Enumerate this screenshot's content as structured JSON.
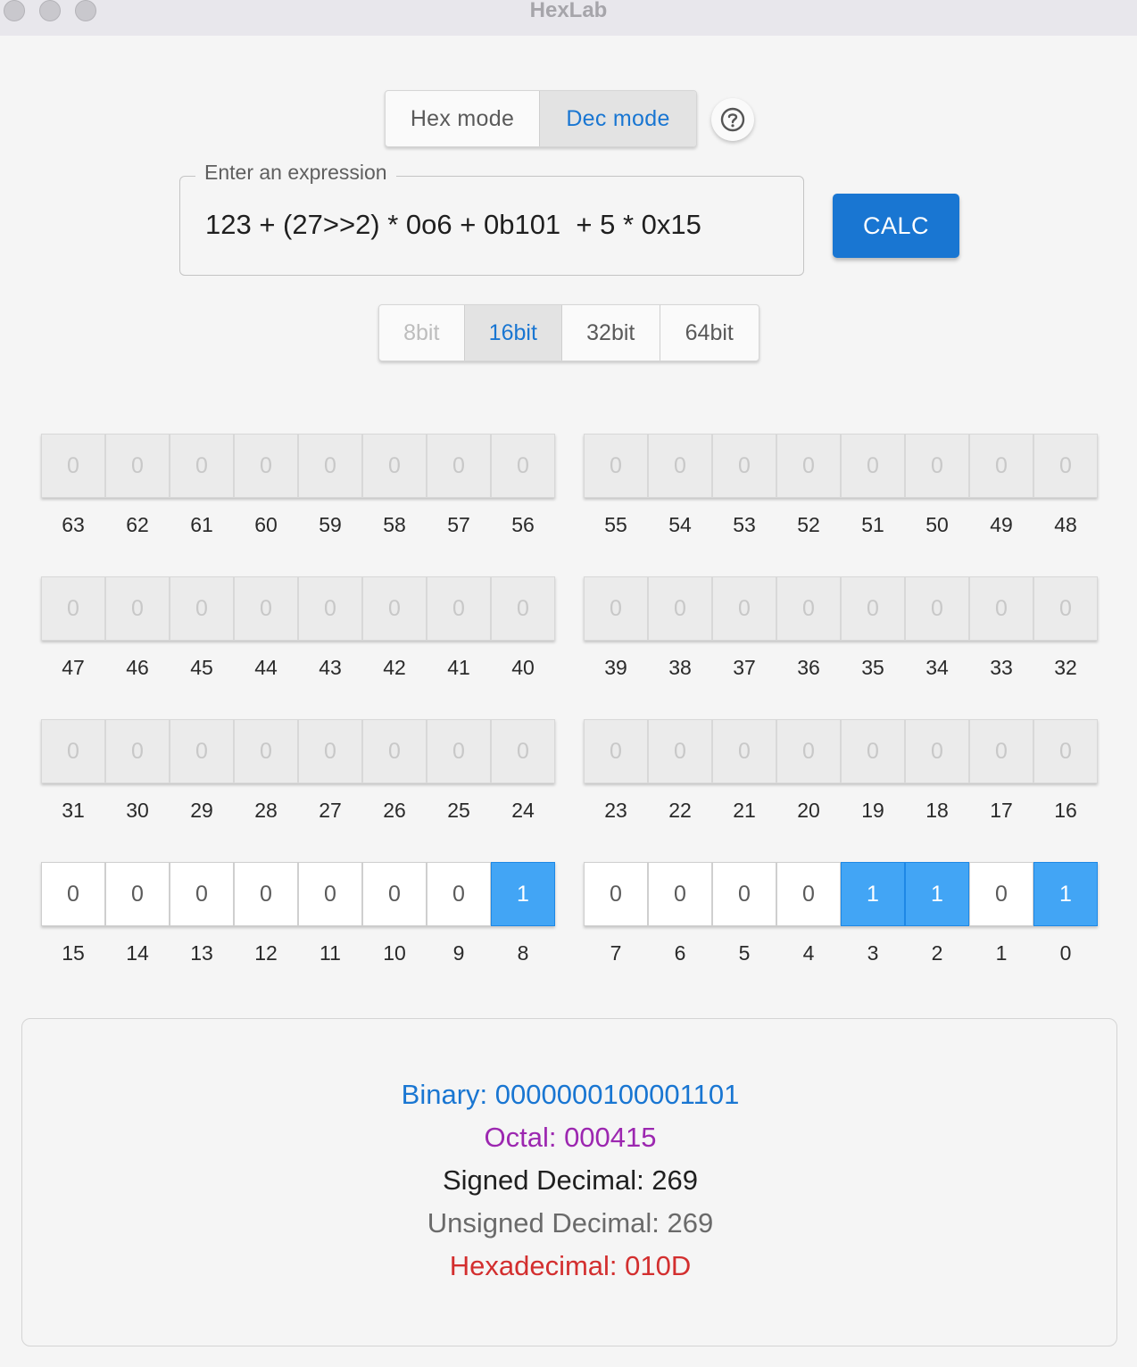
{
  "window": {
    "title": "HexLab"
  },
  "mode": {
    "hex_label": "Hex mode",
    "dec_label": "Dec mode",
    "selected": "Dec mode"
  },
  "help": {
    "icon": "help-circle-icon"
  },
  "expression": {
    "legend": "Enter an expression",
    "value": "123 + (27>>2) * 0o6 + 0b101  + 5 * 0x15"
  },
  "calc": {
    "label": "CALC"
  },
  "bit_width": {
    "options": [
      "8bit",
      "16bit",
      "32bit",
      "64bit"
    ],
    "selected": "16bit",
    "disabled": "8bit"
  },
  "bits": {
    "active_bits": 16,
    "values": "0000000100001101"
  },
  "result": {
    "binary": "Binary: 0000000100001101",
    "octal": "Octal: 000415",
    "signed": "Signed Decimal: 269",
    "unsigned": "Unsigned Decimal: 269",
    "hex": "Hexadecimal: 010D"
  },
  "colors": {
    "accent": "#1976d2",
    "bit_on": "#42a5f5",
    "binary": "#1976d2",
    "octal": "#9c27b0",
    "signed": "#1f1f1f",
    "unsigned": "#6a6a6a",
    "hex": "#d32f2f"
  }
}
